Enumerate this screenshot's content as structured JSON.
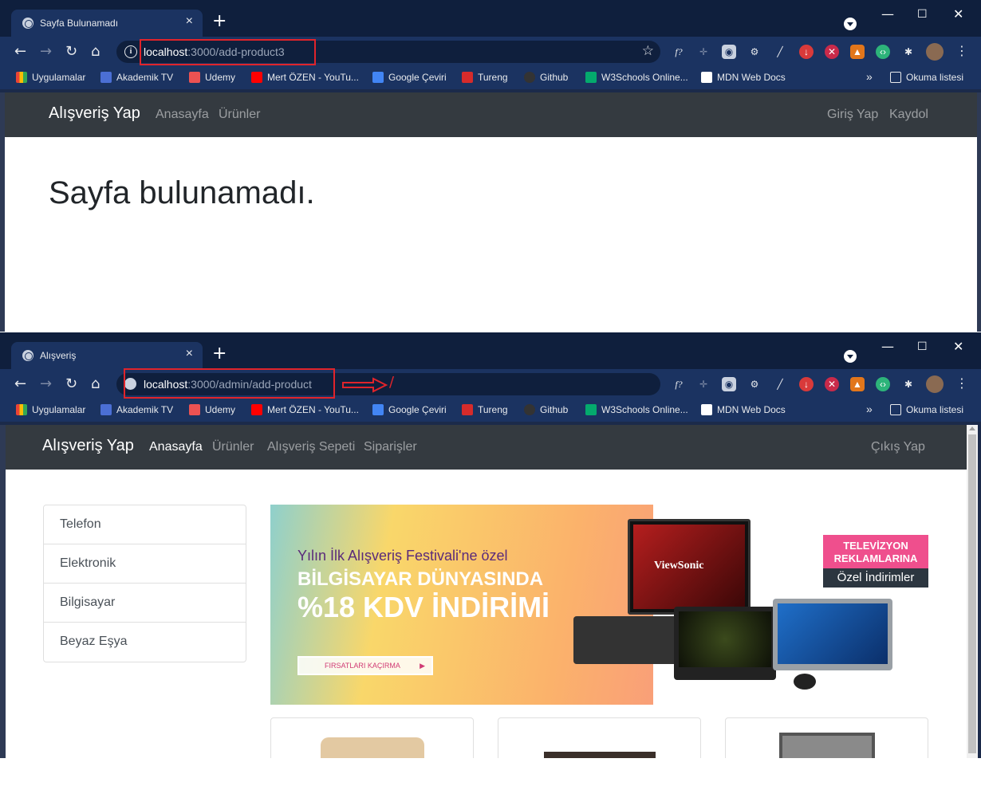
{
  "screen1": {
    "tab_title": "Sayfa Bulunamadı",
    "url_host": "localhost",
    "url_rest": ":3000/add-product3",
    "bookmarks": [
      "Uygulamalar",
      "Akademik TV",
      "Udemy",
      "Mert ÖZEN - YouTu...",
      "Google Çeviri",
      "Tureng",
      "Github",
      "W3Schools Online...",
      "MDN Web Docs"
    ],
    "reading_list": "Okuma listesi",
    "brand": "Alışveriş Yap",
    "nav_links": [
      "Anasayfa",
      "Ürünler"
    ],
    "right_links": [
      "Giriş Yap",
      "Kaydol"
    ],
    "heading": "Sayfa bulunamadı."
  },
  "screen2": {
    "tab_title": "Alışveriş",
    "url_host": "localhost",
    "url_rest": ":3000/admin/add-product",
    "annotation_slash": "/",
    "bookmarks": [
      "Uygulamalar",
      "Akademik TV",
      "Udemy",
      "Mert ÖZEN - YouTu...",
      "Google Çeviri",
      "Tureng",
      "Github",
      "W3Schools Online...",
      "MDN Web Docs"
    ],
    "reading_list": "Okuma listesi",
    "brand": "Alışveriş Yap",
    "nav_links": [
      "Anasayfa",
      "Ürünler",
      "Alışveriş Sepeti",
      "Siparişler"
    ],
    "active_link": "Anasayfa",
    "right_links": [
      "Çıkış Yap"
    ],
    "categories": [
      "Telefon",
      "Elektronik",
      "Bilgisayar",
      "Beyaz Eşya"
    ],
    "banner": {
      "small_text": "Yılın İlk Alışveriş Festivali'ne özel",
      "big_text_1": "BİLGİSAYAR DÜNYASINDA",
      "big_text_2": "%18 KDV İNDİRİMİ",
      "button": "FIRSATLARI KAÇIRMA",
      "tv_line1": "TELEVİZYON",
      "tv_line2": "REKLAMLARINA",
      "tv_line3": "Özel İndirimler",
      "monitor_logo": "ViewSonic"
    }
  },
  "colors": {
    "browser_frame": "#0f1f3d",
    "browser_toolbar": "#1b3361",
    "navbar": "#343a40",
    "highlight": "#e0242b"
  }
}
